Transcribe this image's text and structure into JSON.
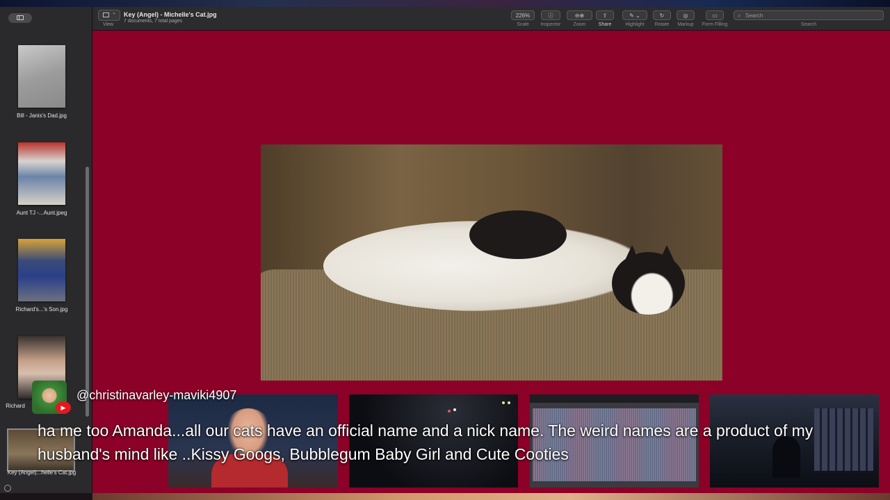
{
  "window": {
    "title": "Key (Angel) - Michelle's Cat.jpg",
    "subtitle": "7 documents, 7 total pages"
  },
  "toolbar": {
    "view_label": "View",
    "scale_value": "226%",
    "scale_label": "Scale",
    "inspector_label": "Inspector",
    "zoom_label": "Zoom",
    "share_label": "Share",
    "highlight_label": "Highlight",
    "rotate_label": "Rotate",
    "markup_label": "Markup",
    "form_filling_label": "Form Filling",
    "search_label": "Search",
    "search_placeholder": "Search"
  },
  "sidebar": {
    "items": [
      {
        "label": "Bill - Janis's Dad.jpg"
      },
      {
        "label": "Aunt TJ -...Aunt.jpeg"
      },
      {
        "label": "Richard's...'s Son.jpg"
      },
      {
        "label": "Richard"
      },
      {
        "label": "Key (Angel)...helle's Cat.jpg"
      }
    ]
  },
  "chat": {
    "username": "@christinavarley-maviki4907",
    "message": "ha me too Amanda...all our cats have an official name and a nick name. The weird names are a product of my husband's mind like ..Kissy Googs, Bubblegum Baby Girl and Cute Cooties"
  },
  "colors": {
    "document_background": "#8c0127",
    "youtube_red": "#e3191e"
  }
}
